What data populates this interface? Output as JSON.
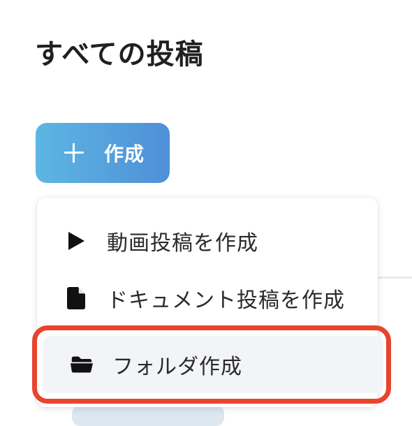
{
  "page": {
    "title": "すべての投稿"
  },
  "create_button": {
    "label": "作成",
    "icon": "plus-icon",
    "gradient_start": "#5db6e2",
    "gradient_end": "#4f8fd8"
  },
  "dropdown": {
    "items": [
      {
        "label": "動画投稿を作成",
        "icon": "play-icon"
      },
      {
        "label": "ドキュメント投稿を作成",
        "icon": "document-icon"
      },
      {
        "label": "フォルダ作成",
        "icon": "folder-icon",
        "highlighted": true
      }
    ]
  },
  "colors": {
    "highlight_ring": "#e8442e",
    "hover_background": "#f3f4f7"
  }
}
